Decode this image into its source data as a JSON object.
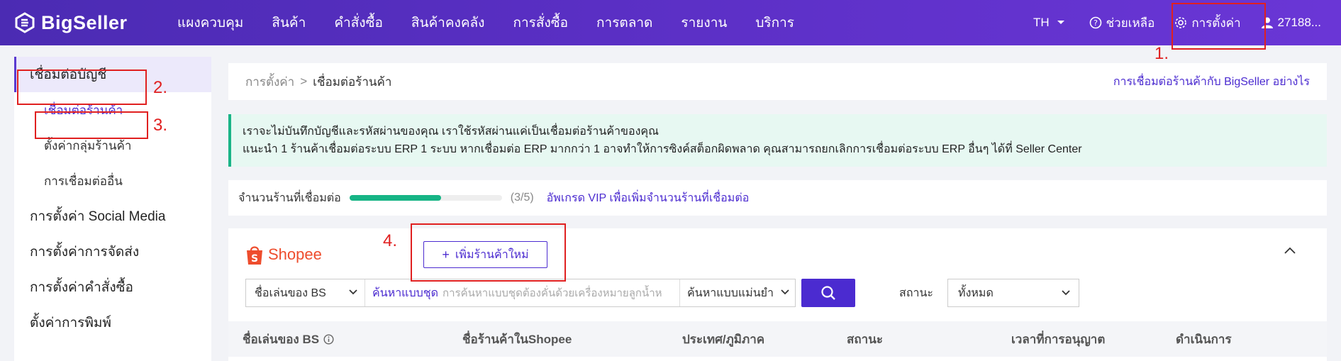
{
  "app": {
    "brand": "BigSeller"
  },
  "nav": {
    "items": [
      "แผงควบคุม",
      "สินค้า",
      "คำสั่งซื้อ",
      "สินค้าคงคลัง",
      "การสั่งซื้อ",
      "การตลาด",
      "รายงาน",
      "บริการ"
    ]
  },
  "top_right": {
    "language": "TH",
    "help": "ช่วยเหลือ",
    "settings": "การตั้งค่า",
    "user": "27188..."
  },
  "sidebar": {
    "group_accounts": "เชื่อมต่อบัญชี",
    "sub_items": [
      "เชื่อมต่อร้านค้า",
      "ตั้งค่ากลุ่มร้านค้า",
      "การเชื่อมต่ออื่น"
    ],
    "groups": [
      "การตั้งค่า Social Media",
      "การตั้งค่าการจัดส่ง",
      "การตั้งค่าคำสั่งซื้อ",
      "ตั้งค่าการพิมพ์"
    ]
  },
  "breadcrumb": {
    "parent": "การตั้งค่า",
    "separator": ">",
    "current": "เชื่อมต่อร้านค้า",
    "help_link": "การเชื่อมต่อร้านค้ากับ BigSeller อย่างไร"
  },
  "notice": {
    "line1": "เราจะไม่บันทึกบัญชีและรหัสผ่านของคุณ เราใช้รหัสผ่านแค่เป็นเชื่อมต่อร้านค้าของคุณ",
    "line2": "แนะนำ 1 ร้านค้าเชื่อมต่อระบบ ERP 1 ระบบ หากเชื่อมต่อ ERP มากกว่า 1 อาจทำให้การซิงค์สต็อกผิดพลาด คุณสามารถยกเลิกการเชื่อมต่อระบบ ERP อื่นๆ ได้ที่ Seller Center"
  },
  "store_count": {
    "label": "จำนวนร้านที่เชื่อมต่อ",
    "count_text": "(3/5)",
    "connected": 3,
    "limit": 5,
    "upgrade_link": "อัพเกรด VIP เพื่อเพิ่มจำนวนร้านที่เชื่อมต่อ"
  },
  "shopee": {
    "logo_text": "Shopee",
    "add_button": "เพิ่มร้านค้าใหม่",
    "search": {
      "field_select": "ชื่อเล่นของ BS",
      "mode_link": "ค้นหาแบบชุด",
      "placeholder": "การค้นหาแบบชุดต้องคั่นด้วยเครื่องหมายลูกน้ำห",
      "match_select": "ค้นหาแบบแม่นยำ"
    },
    "status_label": "สถานะ",
    "status_value": "ทั้งหมด",
    "columns": [
      "ชื่อเล่นของ BS",
      "ชื่อร้านค้าในShopee",
      "ประเทศ/ภูมิภาค",
      "สถานะ",
      "เวลาที่การอนุญาต",
      "ดำเนินการ"
    ]
  },
  "annotations": [
    "1.",
    "2.",
    "3.",
    "4."
  ],
  "colors": {
    "brand": "#5a2fc4",
    "accent": "#4b2bd0",
    "success": "#16b485",
    "shopee": "#ee4d2d",
    "annotation": "#e02020"
  }
}
